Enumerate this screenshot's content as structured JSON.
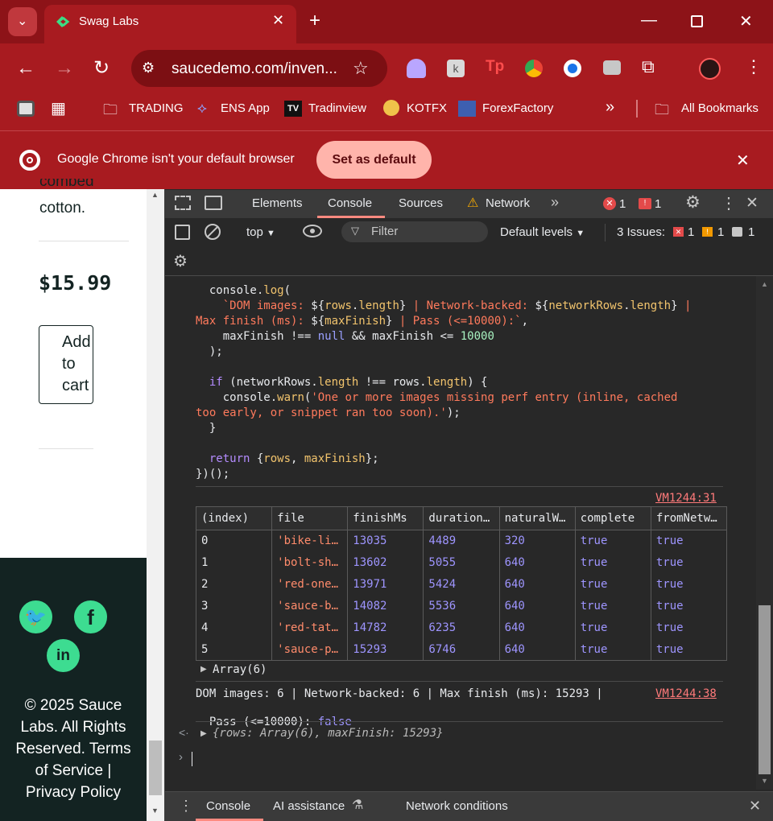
{
  "browser": {
    "tab_title": "Swag Labs",
    "url": "saucedemo.com/inven...",
    "bookmarks": [
      "TRADING",
      "ENS App",
      "Tradinview",
      "KOTFX",
      "ForexFactory"
    ],
    "all_bookmarks": "All Bookmarks",
    "more": "»"
  },
  "infobar": {
    "message": "Google Chrome isn't your default browser",
    "button": "Set as default"
  },
  "page": {
    "desc_tail1": "combed",
    "desc_tail2": "cotton.",
    "price": "$15.99",
    "add_line1": "Add",
    "add_line2": "to",
    "add_line3": "cart",
    "footer_line1": "© 2025 Sauce",
    "footer_line2": "Labs. All Rights",
    "footer_line3": "Reserved. Terms",
    "footer_line4": "of Service |",
    "footer_line5": "Privacy Policy"
  },
  "devtools": {
    "tabs": [
      "Elements",
      "Console",
      "Sources",
      "Network"
    ],
    "errors": "1",
    "warnings": "1",
    "context": "top",
    "filter_placeholder": "Filter",
    "levels": "Default levels",
    "issues_label": "3 Issues:",
    "issues_err": "1",
    "issues_warn": "1",
    "issues_info": "1",
    "source_link1": "VM1244:31",
    "source_link2": "VM1244:38",
    "table_headers": [
      "(index)",
      "file",
      "finishMs",
      "duration…",
      "naturalW…",
      "complete",
      "fromNetw…"
    ],
    "table_rows": [
      [
        "0",
        "'bike-li…",
        "13035",
        "4489",
        "320",
        "true",
        "true"
      ],
      [
        "1",
        "'bolt-sh…",
        "13602",
        "5055",
        "640",
        "true",
        "true"
      ],
      [
        "2",
        "'red-one…",
        "13971",
        "5424",
        "640",
        "true",
        "true"
      ],
      [
        "3",
        "'sauce-b…",
        "14082",
        "5536",
        "640",
        "true",
        "true"
      ],
      [
        "4",
        "'red-tat…",
        "14782",
        "6235",
        "640",
        "true",
        "true"
      ],
      [
        "5",
        "'sauce-p…",
        "15293",
        "6746",
        "640",
        "true",
        "true"
      ]
    ],
    "array_label": "Array(6)",
    "result_line1": "DOM images: 6 | Network-backed: 6 | Max finish (ms): 15293 |",
    "result_line2_prefix": "Pass (<=10000): ",
    "result_line2_value": "false",
    "return_obj": "{rows: Array(6), maxFinish: 15293}",
    "drawer_tabs": [
      "Console",
      "AI assistance",
      "Network conditions"
    ]
  }
}
